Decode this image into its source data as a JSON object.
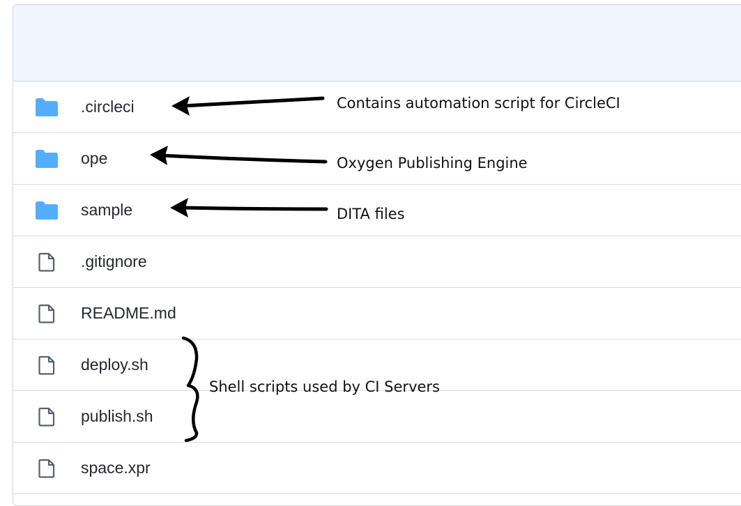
{
  "files": [
    {
      "name": ".circleci",
      "type": "folder",
      "icon": "folder-icon"
    },
    {
      "name": "ope",
      "type": "folder",
      "icon": "folder-icon"
    },
    {
      "name": "sample",
      "type": "folder",
      "icon": "folder-icon"
    },
    {
      "name": ".gitignore",
      "type": "file",
      "icon": "file-icon"
    },
    {
      "name": "README.md",
      "type": "file",
      "icon": "file-icon"
    },
    {
      "name": "deploy.sh",
      "type": "file",
      "icon": "file-icon"
    },
    {
      "name": "publish.sh",
      "type": "file",
      "icon": "file-icon"
    },
    {
      "name": "space.xpr",
      "type": "file",
      "icon": "file-icon"
    }
  ],
  "annotations": {
    "circleci": "Contains automation script for CircleCI",
    "ope": "Oxygen Publishing Engine",
    "sample": "DITA files",
    "shell_scripts": "Shell scripts used by CI Servers"
  },
  "colors": {
    "folder": "#54aeff",
    "file": "#57606a",
    "header_bg": "#f0f6fd",
    "border": "#d0d7de"
  }
}
